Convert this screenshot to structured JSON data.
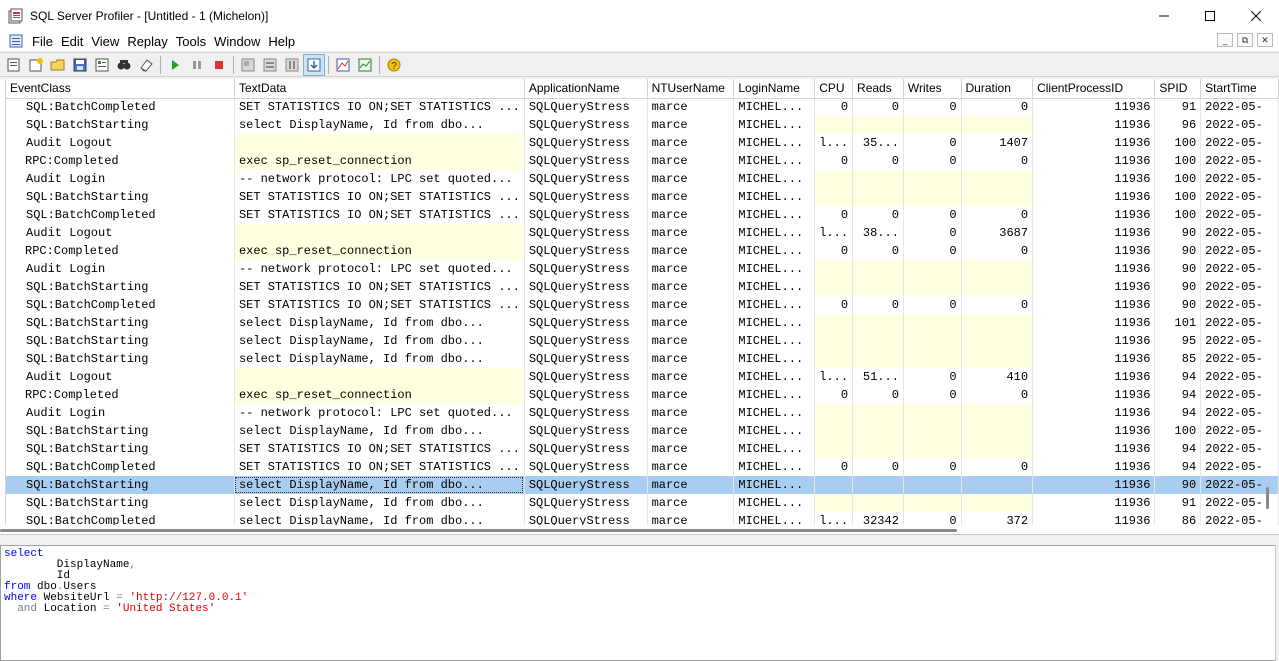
{
  "window": {
    "title": "SQL Server Profiler - [Untitled - 1 (Michelon)]",
    "minimize_glyph": "—",
    "maximize_glyph": "☐",
    "close_glyph": "✕"
  },
  "menu": [
    "File",
    "Edit",
    "View",
    "Replay",
    "Tools",
    "Window",
    "Help"
  ],
  "mdi_buttons": [
    "_",
    "⧉",
    "✕"
  ],
  "toolbar_icons": [
    "new-trace-icon",
    "new-template-icon",
    "open-icon",
    "save-icon",
    "properties-icon",
    "find-icon",
    "clear-icon",
    "start-icon",
    "pause-icon",
    "stop-icon",
    "step-icon",
    "run-to-cursor-icon",
    "auto-scroll-icon",
    "show-hide-icon",
    "perfmon-icon",
    "activity-monitor-icon",
    "help-icon"
  ],
  "columns": [
    "EventClass",
    "TextData",
    "ApplicationName",
    "NTUserName",
    "LoginName",
    "CPU",
    "Reads",
    "Writes",
    "Duration",
    "ClientProcessID",
    "SPID",
    "StartTime"
  ],
  "rows": [
    {
      "ev": "SQL:BatchCompleted",
      "text": "SET STATISTICS IO ON;SET STATISTICS ...",
      "app": "SQLQueryStress",
      "nt": "marce",
      "login": "MICHEL...",
      "cpu": "0",
      "reads": "0",
      "writes": "0",
      "dur": "0",
      "cpid": "11936",
      "spid": "91",
      "start": "2022-05-",
      "yel": false
    },
    {
      "ev": "SQL:BatchStarting",
      "text": "select   DisplayName,   Id  from dbo...",
      "app": "SQLQueryStress",
      "nt": "marce",
      "login": "MICHEL...",
      "cpu": "",
      "reads": "",
      "writes": "",
      "dur": "",
      "cpid": "11936",
      "spid": "96",
      "start": "2022-05-",
      "yel": true
    },
    {
      "ev": "Audit Logout",
      "text": "",
      "app": "SQLQueryStress",
      "nt": "marce",
      "login": "MICHEL...",
      "cpu": "l...",
      "reads": "35...",
      "writes": "0",
      "dur": "1407",
      "cpid": "11936",
      "spid": "100",
      "start": "2022-05-",
      "yel": false,
      "textyel": true
    },
    {
      "ev": "RPC:Completed",
      "text": "exec sp_reset_connection",
      "app": "SQLQueryStress",
      "nt": "marce",
      "login": "MICHEL...",
      "cpu": "0",
      "reads": "0",
      "writes": "0",
      "dur": "0",
      "cpid": "11936",
      "spid": "100",
      "start": "2022-05-",
      "yel": false,
      "textyel": true
    },
    {
      "ev": "Audit Login",
      "text": "-- network protocol: LPC  set quoted...",
      "app": "SQLQueryStress",
      "nt": "marce",
      "login": "MICHEL...",
      "cpu": "",
      "reads": "",
      "writes": "",
      "dur": "",
      "cpid": "11936",
      "spid": "100",
      "start": "2022-05-",
      "yel": true
    },
    {
      "ev": "SQL:BatchStarting",
      "text": "SET STATISTICS IO ON;SET STATISTICS ...",
      "app": "SQLQueryStress",
      "nt": "marce",
      "login": "MICHEL...",
      "cpu": "",
      "reads": "",
      "writes": "",
      "dur": "",
      "cpid": "11936",
      "spid": "100",
      "start": "2022-05-",
      "yel": true
    },
    {
      "ev": "SQL:BatchCompleted",
      "text": "SET STATISTICS IO ON;SET STATISTICS ...",
      "app": "SQLQueryStress",
      "nt": "marce",
      "login": "MICHEL...",
      "cpu": "0",
      "reads": "0",
      "writes": "0",
      "dur": "0",
      "cpid": "11936",
      "spid": "100",
      "start": "2022-05-",
      "yel": false
    },
    {
      "ev": "Audit Logout",
      "text": "",
      "app": "SQLQueryStress",
      "nt": "marce",
      "login": "MICHEL...",
      "cpu": "l...",
      "reads": "38...",
      "writes": "0",
      "dur": "3687",
      "cpid": "11936",
      "spid": "90",
      "start": "2022-05-",
      "yel": false,
      "textyel": true
    },
    {
      "ev": "RPC:Completed",
      "text": "exec sp_reset_connection",
      "app": "SQLQueryStress",
      "nt": "marce",
      "login": "MICHEL...",
      "cpu": "0",
      "reads": "0",
      "writes": "0",
      "dur": "0",
      "cpid": "11936",
      "spid": "90",
      "start": "2022-05-",
      "yel": false,
      "textyel": true
    },
    {
      "ev": "Audit Login",
      "text": "-- network protocol: LPC  set quoted...",
      "app": "SQLQueryStress",
      "nt": "marce",
      "login": "MICHEL...",
      "cpu": "",
      "reads": "",
      "writes": "",
      "dur": "",
      "cpid": "11936",
      "spid": "90",
      "start": "2022-05-",
      "yel": true
    },
    {
      "ev": "SQL:BatchStarting",
      "text": "SET STATISTICS IO ON;SET STATISTICS ...",
      "app": "SQLQueryStress",
      "nt": "marce",
      "login": "MICHEL...",
      "cpu": "",
      "reads": "",
      "writes": "",
      "dur": "",
      "cpid": "11936",
      "spid": "90",
      "start": "2022-05-",
      "yel": true
    },
    {
      "ev": "SQL:BatchCompleted",
      "text": "SET STATISTICS IO ON;SET STATISTICS ...",
      "app": "SQLQueryStress",
      "nt": "marce",
      "login": "MICHEL...",
      "cpu": "0",
      "reads": "0",
      "writes": "0",
      "dur": "0",
      "cpid": "11936",
      "spid": "90",
      "start": "2022-05-",
      "yel": false
    },
    {
      "ev": "SQL:BatchStarting",
      "text": "select   DisplayName,   Id  from dbo...",
      "app": "SQLQueryStress",
      "nt": "marce",
      "login": "MICHEL...",
      "cpu": "",
      "reads": "",
      "writes": "",
      "dur": "",
      "cpid": "11936",
      "spid": "101",
      "start": "2022-05-",
      "yel": true
    },
    {
      "ev": "SQL:BatchStarting",
      "text": "select   DisplayName,   Id  from dbo...",
      "app": "SQLQueryStress",
      "nt": "marce",
      "login": "MICHEL...",
      "cpu": "",
      "reads": "",
      "writes": "",
      "dur": "",
      "cpid": "11936",
      "spid": "95",
      "start": "2022-05-",
      "yel": true
    },
    {
      "ev": "SQL:BatchStarting",
      "text": "select   DisplayName,   Id  from dbo...",
      "app": "SQLQueryStress",
      "nt": "marce",
      "login": "MICHEL...",
      "cpu": "",
      "reads": "",
      "writes": "",
      "dur": "",
      "cpid": "11936",
      "spid": "85",
      "start": "2022-05-",
      "yel": true
    },
    {
      "ev": "Audit Logout",
      "text": "",
      "app": "SQLQueryStress",
      "nt": "marce",
      "login": "MICHEL...",
      "cpu": "l...",
      "reads": "51...",
      "writes": "0",
      "dur": "410",
      "cpid": "11936",
      "spid": "94",
      "start": "2022-05-",
      "yel": false,
      "textyel": true
    },
    {
      "ev": "RPC:Completed",
      "text": "exec sp_reset_connection",
      "app": "SQLQueryStress",
      "nt": "marce",
      "login": "MICHEL...",
      "cpu": "0",
      "reads": "0",
      "writes": "0",
      "dur": "0",
      "cpid": "11936",
      "spid": "94",
      "start": "2022-05-",
      "yel": false,
      "textyel": true
    },
    {
      "ev": "Audit Login",
      "text": "-- network protocol: LPC  set quoted...",
      "app": "SQLQueryStress",
      "nt": "marce",
      "login": "MICHEL...",
      "cpu": "",
      "reads": "",
      "writes": "",
      "dur": "",
      "cpid": "11936",
      "spid": "94",
      "start": "2022-05-",
      "yel": true
    },
    {
      "ev": "SQL:BatchStarting",
      "text": "select   DisplayName,   Id  from dbo...",
      "app": "SQLQueryStress",
      "nt": "marce",
      "login": "MICHEL...",
      "cpu": "",
      "reads": "",
      "writes": "",
      "dur": "",
      "cpid": "11936",
      "spid": "100",
      "start": "2022-05-",
      "yel": true
    },
    {
      "ev": "SQL:BatchStarting",
      "text": "SET STATISTICS IO ON;SET STATISTICS ...",
      "app": "SQLQueryStress",
      "nt": "marce",
      "login": "MICHEL...",
      "cpu": "",
      "reads": "",
      "writes": "",
      "dur": "",
      "cpid": "11936",
      "spid": "94",
      "start": "2022-05-",
      "yel": true
    },
    {
      "ev": "SQL:BatchCompleted",
      "text": "SET STATISTICS IO ON;SET STATISTICS ...",
      "app": "SQLQueryStress",
      "nt": "marce",
      "login": "MICHEL...",
      "cpu": "0",
      "reads": "0",
      "writes": "0",
      "dur": "0",
      "cpid": "11936",
      "spid": "94",
      "start": "2022-05-",
      "yel": false
    },
    {
      "ev": "SQL:BatchStarting",
      "text": "select   DisplayName,   Id  from dbo...",
      "app": "SQLQueryStress",
      "nt": "marce",
      "login": "MICHEL...",
      "cpu": "",
      "reads": "",
      "writes": "",
      "dur": "",
      "cpid": "11936",
      "spid": "90",
      "start": "2022-05-",
      "yel": true,
      "selected": true
    },
    {
      "ev": "SQL:BatchStarting",
      "text": "select   DisplayName,   Id  from dbo...",
      "app": "SQLQueryStress",
      "nt": "marce",
      "login": "MICHEL...",
      "cpu": "",
      "reads": "",
      "writes": "",
      "dur": "",
      "cpid": "11936",
      "spid": "91",
      "start": "2022-05-",
      "yel": true
    },
    {
      "ev": "SQL:BatchCompleted",
      "text": "select   DisplayName,   Id  from dbo...",
      "app": "SQLQueryStress",
      "nt": "marce",
      "login": "MICHEL...",
      "cpu": "l...",
      "reads": "32342",
      "writes": "0",
      "dur": "372",
      "cpid": "11936",
      "spid": "86",
      "start": "2022-05-",
      "yel": false
    }
  ],
  "text_pane": {
    "lines": [
      [
        {
          "t": "select",
          "c": "kw"
        }
      ],
      [
        {
          "t": "        DisplayName",
          "c": ""
        },
        {
          "t": ",",
          "c": "gray"
        }
      ],
      [
        {
          "t": "        Id",
          "c": ""
        }
      ],
      [
        {
          "t": "from",
          "c": "kw"
        },
        {
          "t": " dbo",
          "c": ""
        },
        {
          "t": ".",
          "c": "gray"
        },
        {
          "t": "Users",
          "c": ""
        }
      ],
      [
        {
          "t": "where",
          "c": "kw"
        },
        {
          "t": " WebsiteUrl ",
          "c": ""
        },
        {
          "t": "=",
          "c": "gray"
        },
        {
          "t": " 'http://127.0.0.1'",
          "c": "str"
        }
      ],
      [
        {
          "t": "  ",
          "c": ""
        },
        {
          "t": "and",
          "c": "gray"
        },
        {
          "t": " Location ",
          "c": ""
        },
        {
          "t": "=",
          "c": "gray"
        },
        {
          "t": " 'United States'",
          "c": "str"
        }
      ]
    ]
  }
}
